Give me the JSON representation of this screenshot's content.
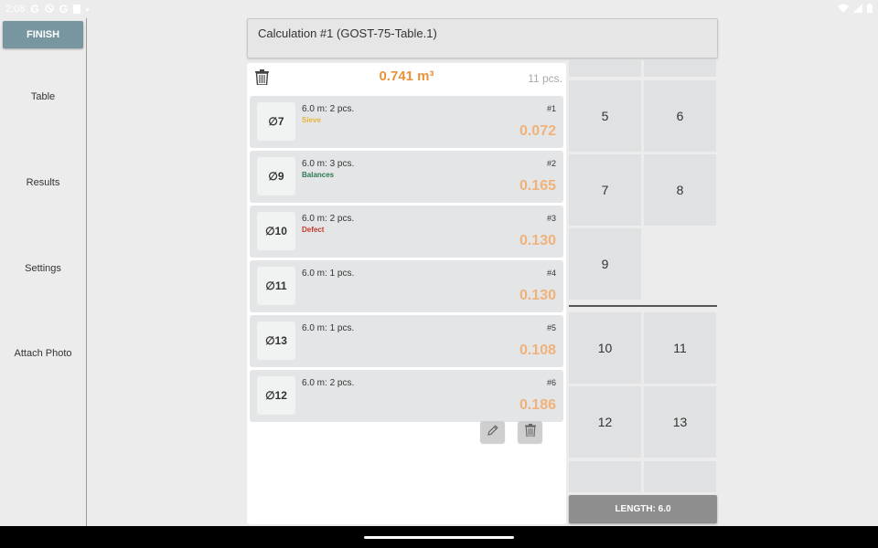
{
  "status_bar": {
    "time": "2:08",
    "icons": [
      "google-icon",
      "blocked-icon",
      "google-icon",
      "sd-card-icon",
      "dot-icon",
      "wifi-icon",
      "signal-icon",
      "battery-icon"
    ]
  },
  "sidebar": {
    "finish_label": "FINISH",
    "items": [
      {
        "label": "Table"
      },
      {
        "label": "Results"
      },
      {
        "label": "Settings"
      },
      {
        "label": "Attach Photo"
      }
    ]
  },
  "header": {
    "title": "Calculation #1 (GOST-75-Table.1)"
  },
  "summary": {
    "total_volume": "0.741 m³",
    "pieces": "11 pcs."
  },
  "rows": [
    {
      "diameter": "∅7",
      "info": "6.0 m:  2 pcs.",
      "tag": "Sieve",
      "tag_color": "#e7b33a",
      "number": "#1",
      "volume": "0.072"
    },
    {
      "diameter": "∅9",
      "info": "6.0 m:  3 pcs.",
      "tag": "Balances",
      "tag_color": "#2d7a52",
      "number": "#2",
      "volume": "0.165"
    },
    {
      "diameter": "∅10",
      "info": "6.0 m:  2 pcs.",
      "tag": "Defect",
      "tag_color": "#c0392b",
      "number": "#3",
      "volume": "0.130"
    },
    {
      "diameter": "∅11",
      "info": "6.0 m:  1 pcs.",
      "tag": "",
      "tag_color": "#333333",
      "number": "#4",
      "volume": "0.130"
    },
    {
      "diameter": "∅13",
      "info": "6.0 m:  1 pcs.",
      "tag": "",
      "tag_color": "#333333",
      "number": "#5",
      "volume": "0.108"
    },
    {
      "diameter": "∅12",
      "info": "6.0 m:  2 pcs.",
      "tag": "",
      "tag_color": "#333333",
      "number": "#6",
      "volume": "0.186"
    }
  ],
  "keypad": {
    "keys": [
      "5",
      "6",
      "7",
      "8",
      "9",
      "10",
      "11",
      "12",
      "13"
    ],
    "length_label": "LENGTH: 6.0"
  },
  "colors": {
    "accent": "#e8923a",
    "finish_button": "#7896a0",
    "length_button": "#8e8e8e"
  }
}
